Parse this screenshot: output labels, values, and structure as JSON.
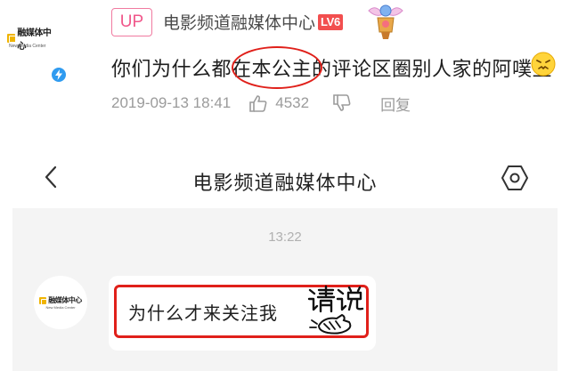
{
  "comment": {
    "up_label": "UP",
    "user_name": "电影频道融媒体中心",
    "level": "LV6",
    "text": "你们为什么都在本公主的评论区圈别人家的阿噗主",
    "timestamp": "2019-09-13 18:41",
    "like_count": "4532",
    "reply_label": "回复",
    "avatar_logo": "融媒体中心",
    "avatar_logo_sub": "New Media Center",
    "avatar_badge_icon": "lightning-icon",
    "accent_color": "#f0568a",
    "level_color": "#f24f4f",
    "highlight_color": "#e0201a"
  },
  "chat": {
    "title": "电影频道融媒体中心",
    "back_icon": "chevron-left-icon",
    "settings_icon": "hexagon-settings-icon",
    "time_divider": "13:22",
    "avatar_logo": "融媒体中心",
    "avatar_logo_sub": "New Media Center",
    "message_text": "为什么才来关注我",
    "sticker_text": "请说",
    "background_color": "#f4f4f4"
  }
}
